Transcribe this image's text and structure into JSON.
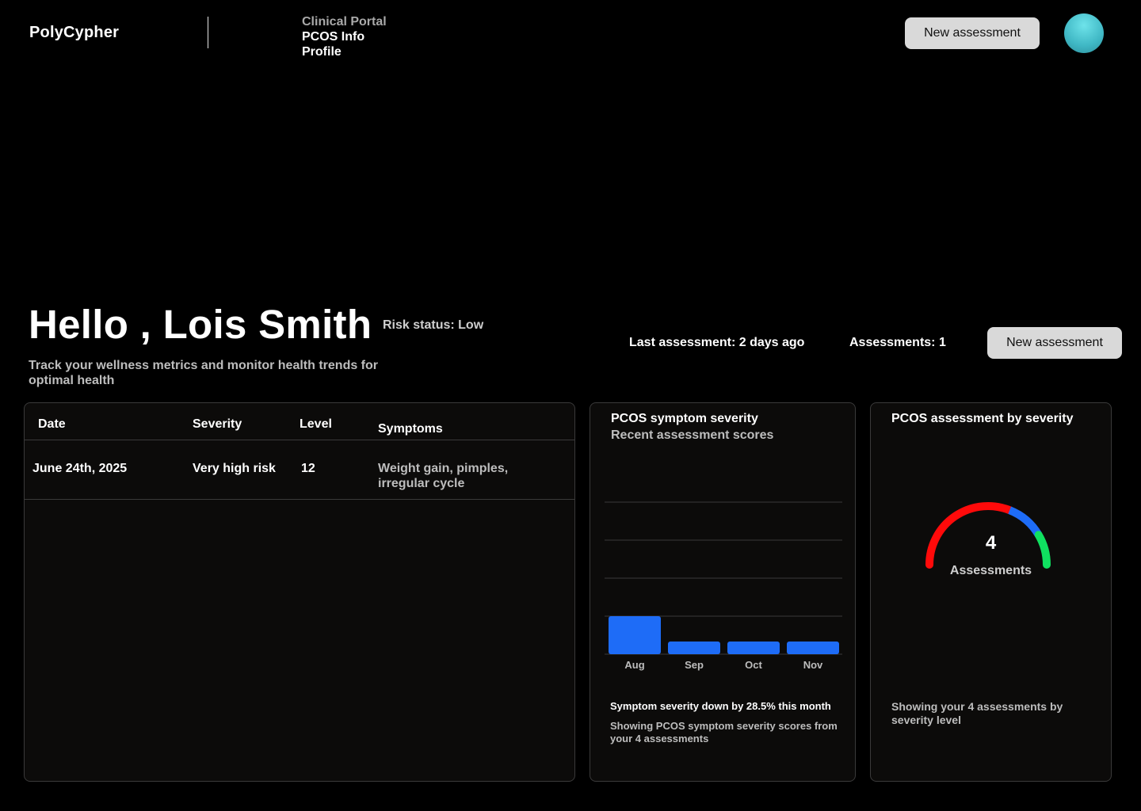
{
  "header": {
    "logo": "PolyCypher",
    "nav": [
      "Clinical Portal",
      "PCOS Info",
      "Profile"
    ],
    "new_assessment_label": "New assessment"
  },
  "hero": {
    "greeting": "Hello , Lois Smith",
    "risk_status": "Risk status: Low",
    "subtitle": "Track your wellness metrics and monitor health trends for optimal health",
    "last_assessment": "Last assessment: 2 days ago",
    "assessments_count": "Assessments: 1",
    "new_assessment_label": "New assessment"
  },
  "table": {
    "headers": [
      "Date",
      "Severity",
      "Level",
      "Symptoms"
    ],
    "rows": [
      [
        "June 24th, 2025",
        "Very high risk",
        "12",
        "Weight gain, pimples, irregular cycle"
      ]
    ]
  },
  "bar_card": {
    "title": "PCOS symptom severity",
    "subtitle": "Recent assessment scores",
    "footer_title": "Symptom severity down by 28.5% this month",
    "footer_text": "Showing PCOS symptom severity scores from your 4 assessments"
  },
  "chart_data": {
    "type": "bar",
    "title": "PCOS symptom severity",
    "subtitle": "Recent assessment scores",
    "categories": [
      "Aug",
      "Sep",
      "Oct",
      "Nov"
    ],
    "values": [
      12,
      4,
      4,
      4
    ],
    "ylim": [
      0,
      48
    ],
    "grid": true,
    "bar_color": "#1e6cf7"
  },
  "gauge_card": {
    "title": "PCOS assessment by severity",
    "value": "4",
    "value_label": "Assessments",
    "footer_text": "Showing your 4 assessments by severity level",
    "segments": [
      {
        "fraction": 0.62,
        "color": "#ff0a0a"
      },
      {
        "fraction": 0.21,
        "color": "#1e6cf7"
      },
      {
        "fraction": 0.17,
        "color": "#10e060"
      }
    ]
  },
  "colors": {
    "background": "#000000",
    "card": "#0c0b0a",
    "button": "#d9d9d9",
    "accent_blue": "#1e6cf7",
    "avatar": "#4fc6d2"
  }
}
